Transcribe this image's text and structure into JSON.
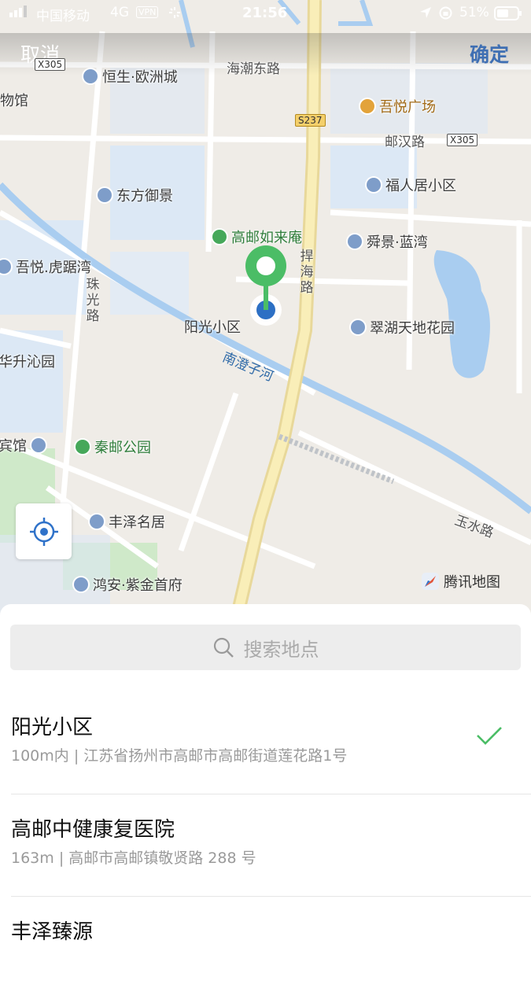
{
  "status": {
    "carrier": "中国移动",
    "network": "4G",
    "vpn": "VPN",
    "time": "21:56",
    "battery": "51%"
  },
  "header": {
    "cancel_label": "取消",
    "confirm_label": "确定"
  },
  "map": {
    "pois": {
      "hengsheng": "恒生·欧洲城",
      "wuyue_plaza": "吾悦广场",
      "fuyuan": "福人居小区",
      "dongfang": "东方御景",
      "rulaian": "高邮如来庵",
      "shunjing": "舜景·蓝湾",
      "wuyue_hujuwan": "吾悦.虎踞湾",
      "yangguang": "阳光小区",
      "cuihu": "翠湖天地花园",
      "huasheng": "华升沁园",
      "binguan": "宾馆",
      "qinyou_park": "秦邮公园",
      "fengze": "丰泽名居",
      "hongan": "鸿安·紫金首府",
      "wuguan": "物馆"
    },
    "roads": {
      "haichao_east": "海潮东路",
      "youhan": "邮汉路",
      "hanhai": "捍海路",
      "zhuguang": "珠光路",
      "yushui": "玉水路"
    },
    "river": "南澄子河",
    "tags": {
      "x305_a": "X305",
      "s237": "S237",
      "x305_b": "X305"
    },
    "provider": "腾讯地图"
  },
  "search": {
    "placeholder": "搜索地点"
  },
  "results": [
    {
      "name": "阳光小区",
      "address": "100m内 | 江苏省扬州市高邮市高邮街道莲花路1号",
      "selected": true
    },
    {
      "name": "高邮中健康复医院",
      "address": "163m | 高邮市高邮镇敬贤路 288 号",
      "selected": false
    },
    {
      "name": "丰泽臻源",
      "address": "",
      "selected": false
    }
  ],
  "colors": {
    "confirm": "#3f6fb3",
    "pin": "#4bbd66",
    "check": "#4bbd66",
    "road_major": "#f7e6a3",
    "water": "#a9cdf0"
  }
}
